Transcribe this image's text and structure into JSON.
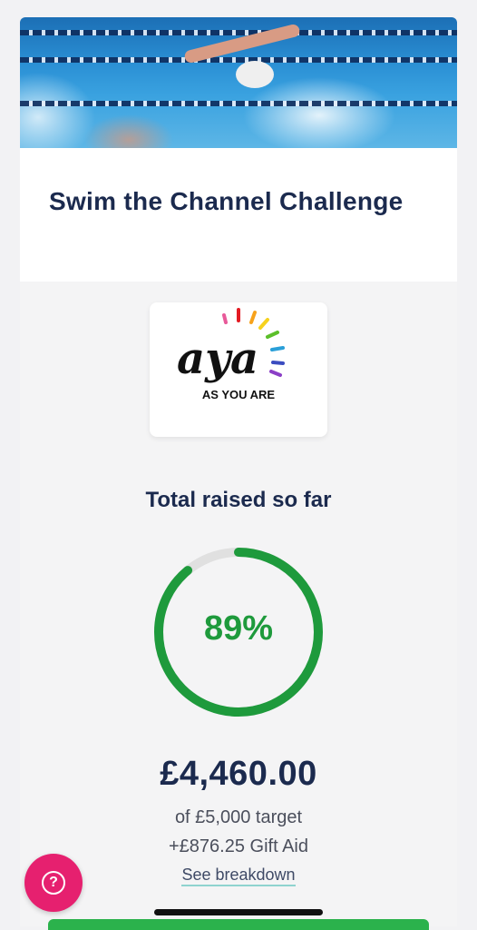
{
  "campaign": {
    "title": "Swim the Channel Challenge",
    "hero_image": "swimmer-in-pool"
  },
  "charity_logo": {
    "wordmark": "aya",
    "tagline": "AS YOU ARE"
  },
  "fundraising": {
    "heading": "Total raised so far",
    "percent_label": "89%",
    "progress_fraction": 0.89,
    "amount_raised": "£4,460.00",
    "target_text": "of £5,000 target",
    "gift_aid_text": "+£876.25 Gift Aid",
    "breakdown_link": "See breakdown"
  },
  "help_button": {
    "icon": "question-icon",
    "glyph": "?"
  },
  "colors": {
    "navy": "#1b2a4e",
    "green": "#1e9a3c",
    "track": "#e0e0e0",
    "help_pink": "#e6206f",
    "link_underline": "#8fd3cf"
  }
}
